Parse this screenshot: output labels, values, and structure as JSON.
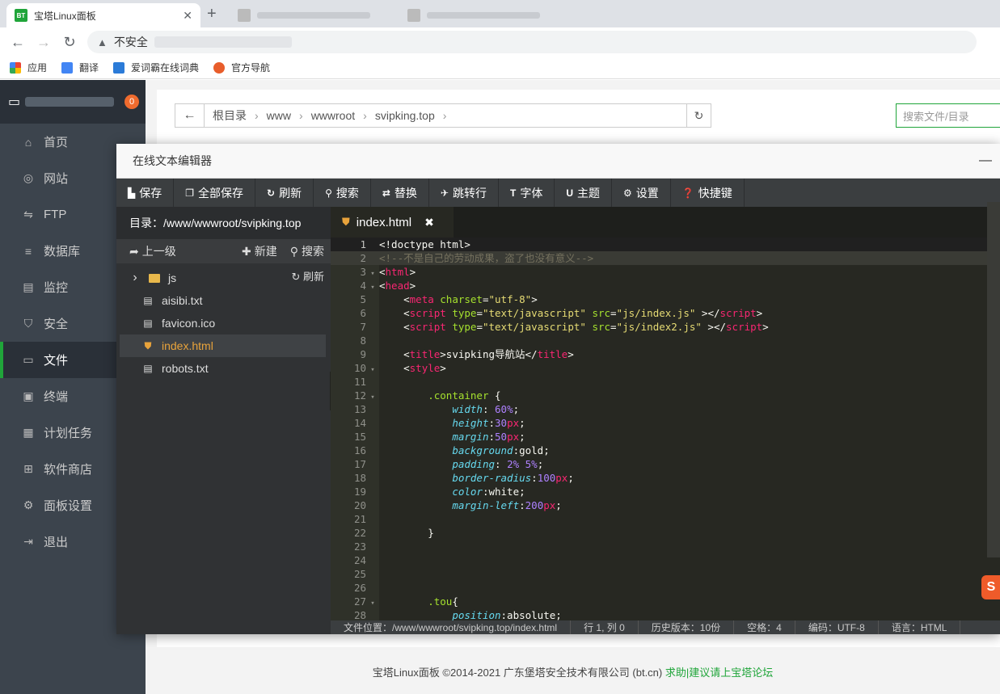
{
  "browser": {
    "active_tab": {
      "favicon": "BT",
      "title": "宝塔Linux面板",
      "close": "✕"
    },
    "new_tab": "+",
    "address": {
      "security": "不安全"
    },
    "bookmarks": [
      {
        "label": "应用",
        "icon": "apps-icon"
      },
      {
        "label": "翻译",
        "icon": "translate-icon"
      },
      {
        "label": "爱词霸在线词典",
        "icon": "dictionary-icon"
      },
      {
        "label": "官方导航",
        "icon": "navigation-icon"
      }
    ]
  },
  "sidebar": {
    "badge": "0",
    "items": [
      {
        "label": "首页",
        "icon": "⌂"
      },
      {
        "label": "网站",
        "icon": "◎"
      },
      {
        "label": "FTP",
        "icon": "⇋"
      },
      {
        "label": "数据库",
        "icon": "≡"
      },
      {
        "label": "监控",
        "icon": "▤"
      },
      {
        "label": "安全",
        "icon": "⛉"
      },
      {
        "label": "文件",
        "icon": "▭"
      },
      {
        "label": "终端",
        "icon": "▣"
      },
      {
        "label": "计划任务",
        "icon": "▦"
      },
      {
        "label": "软件商店",
        "icon": "⊞"
      },
      {
        "label": "面板设置",
        "icon": "⚙"
      },
      {
        "label": "退出",
        "icon": "⇥"
      }
    ],
    "active_index": 6
  },
  "breadcrumb": {
    "back": "←",
    "parts": [
      "根目录",
      "www",
      "wwwroot",
      "svipking.top"
    ],
    "separator": "›",
    "refresh": "↻"
  },
  "search_files": {
    "placeholder": "搜索文件/目录"
  },
  "footer": {
    "text": "宝塔Linux面板 ©2014-2021 广东堡塔安全技术有限公司 (bt.cn)",
    "link": "求助|建议请上宝塔论坛"
  },
  "editor": {
    "title": "在线文本编辑器",
    "minimize": "—",
    "toolbar": [
      {
        "icon": "save-icon",
        "glyph": "▙",
        "label": "保存"
      },
      {
        "icon": "save-all-icon",
        "glyph": "❐",
        "label": "全部保存"
      },
      {
        "icon": "refresh-icon",
        "glyph": "↻",
        "label": "刷新"
      },
      {
        "icon": "search-icon",
        "glyph": "⚲",
        "label": "搜索"
      },
      {
        "icon": "replace-icon",
        "glyph": "⇄",
        "label": "替换"
      },
      {
        "icon": "goto-line-icon",
        "glyph": "✈",
        "label": "跳转行"
      },
      {
        "icon": "font-icon",
        "glyph": "T",
        "label": "字体"
      },
      {
        "icon": "theme-icon",
        "glyph": "U",
        "label": "主题"
      },
      {
        "icon": "settings-icon",
        "glyph": "⚙",
        "label": "设置"
      },
      {
        "icon": "shortcut-icon",
        "glyph": "❓",
        "label": "快捷键"
      }
    ],
    "directory": "目录：/www/wwwroot/svipking.top",
    "actions": {
      "up": "上一级",
      "new": "新建",
      "search": "搜索",
      "refresh": "刷新"
    },
    "files": [
      {
        "name": "js",
        "type": "folder"
      },
      {
        "name": "aisibi.txt",
        "type": "file"
      },
      {
        "name": "favicon.ico",
        "type": "file"
      },
      {
        "name": "index.html",
        "type": "html"
      },
      {
        "name": "robots.txt",
        "type": "file"
      }
    ],
    "active_tab": {
      "name": "index.html",
      "close": "✖"
    },
    "code_lines": [
      {
        "n": "1",
        "fold": "",
        "html": "<span style='color:#f8f8f2'>&lt;!doctype html&gt;</span>"
      },
      {
        "n": "2",
        "fold": "",
        "html": "<span style='color:#75715e'>&lt;!--不是自己的劳动成果，盗了也没有意义--&gt;</span>"
      },
      {
        "n": "3",
        "fold": "▾",
        "html": "&lt;<span style='color:#f92672'>html</span>&gt;"
      },
      {
        "n": "4",
        "fold": "▾",
        "html": "&lt;<span style='color:#f92672'>head</span>&gt;"
      },
      {
        "n": "5",
        "fold": "",
        "html": "    &lt;<span style='color:#f92672'>meta</span> <span style='color:#a6e22e'>charset</span>=<span style='color:#e6db74'>\"utf-8\"</span>&gt;"
      },
      {
        "n": "6",
        "fold": "",
        "html": "    &lt;<span style='color:#f92672'>script</span> <span style='color:#a6e22e'>type</span>=<span style='color:#e6db74'>\"text/javascript\"</span> <span style='color:#a6e22e'>src</span>=<span style='color:#e6db74'>\"js/index.js\"</span> &gt;&lt;/<span style='color:#f92672'>script</span>&gt;"
      },
      {
        "n": "7",
        "fold": "",
        "html": "    &lt;<span style='color:#f92672'>script</span> <span style='color:#a6e22e'>type</span>=<span style='color:#e6db74'>\"text/javascript\"</span> <span style='color:#a6e22e'>src</span>=<span style='color:#e6db74'>\"js/index2.js\"</span> &gt;&lt;/<span style='color:#f92672'>script</span>&gt;"
      },
      {
        "n": "8",
        "fold": "",
        "html": ""
      },
      {
        "n": "9",
        "fold": "",
        "html": "    &lt;<span style='color:#f92672'>title</span>&gt;svipking导航站&lt;/<span style='color:#f92672'>title</span>&gt;"
      },
      {
        "n": "10",
        "fold": "▾",
        "html": "    &lt;<span style='color:#f92672'>style</span>&gt;"
      },
      {
        "n": "11",
        "fold": "",
        "html": ""
      },
      {
        "n": "12",
        "fold": "▾",
        "html": "        <span style='color:#a6e22e'>.container</span> {"
      },
      {
        "n": "13",
        "fold": "",
        "html": "            <i style='color:#66d9ef'>width</i>: <span style='color:#ae81ff'>60%</span>;"
      },
      {
        "n": "14",
        "fold": "",
        "html": "            <i style='color:#66d9ef'>height</i>:<span style='color:#ae81ff'>30</span><span style='color:#f92672'>px</span>;"
      },
      {
        "n": "15",
        "fold": "",
        "html": "            <i style='color:#66d9ef'>margin</i>:<span style='color:#ae81ff'>50</span><span style='color:#f92672'>px</span>;"
      },
      {
        "n": "16",
        "fold": "",
        "html": "            <i style='color:#66d9ef'>background</i>:gold;"
      },
      {
        "n": "17",
        "fold": "",
        "html": "            <i style='color:#66d9ef'>padding</i>: <span style='color:#ae81ff'>2% 5%</span>;"
      },
      {
        "n": "18",
        "fold": "",
        "html": "            <i style='color:#66d9ef'>border-radius</i>:<span style='color:#ae81ff'>100</span><span style='color:#f92672'>px</span>;"
      },
      {
        "n": "19",
        "fold": "",
        "html": "            <i style='color:#66d9ef'>color</i>:white;"
      },
      {
        "n": "20",
        "fold": "",
        "html": "            <i style='color:#66d9ef'>margin-left</i>:<span style='color:#ae81ff'>200</span><span style='color:#f92672'>px</span>;"
      },
      {
        "n": "21",
        "fold": "",
        "html": ""
      },
      {
        "n": "22",
        "fold": "",
        "html": "        }"
      },
      {
        "n": "23",
        "fold": "",
        "html": ""
      },
      {
        "n": "24",
        "fold": "",
        "html": ""
      },
      {
        "n": "25",
        "fold": "",
        "html": ""
      },
      {
        "n": "26",
        "fold": "",
        "html": ""
      },
      {
        "n": "27",
        "fold": "▾",
        "html": "        <span style='color:#a6e22e'>.tou</span>{"
      },
      {
        "n": "28",
        "fold": "",
        "html": "            <i style='color:#66d9ef'>position</i>:absolute;"
      }
    ],
    "status": [
      "文件位置：/www/wwwroot/svipking.top/index.html",
      "行 1, 列 0",
      "历史版本：10份",
      "空格：4",
      "编码：UTF-8",
      "语言：HTML"
    ]
  }
}
